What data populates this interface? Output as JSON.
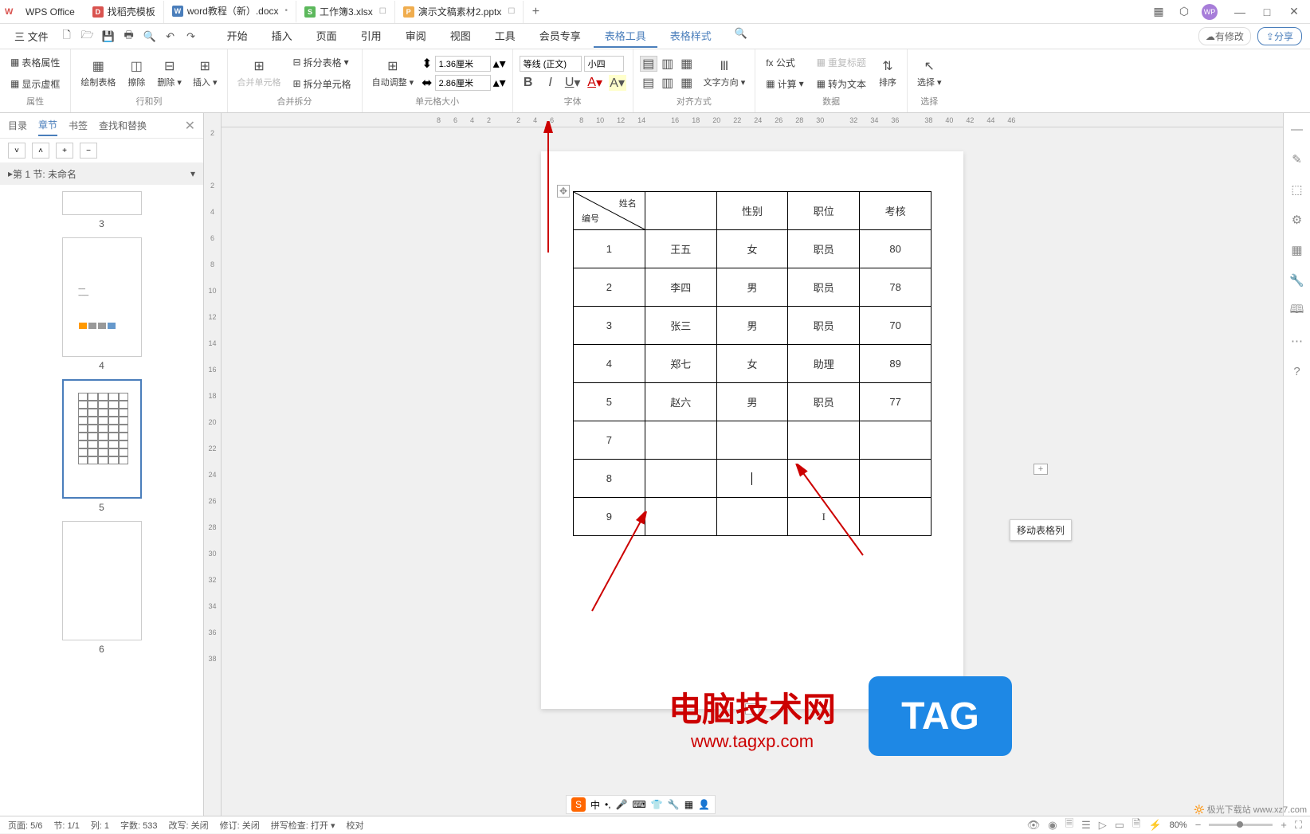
{
  "app": {
    "name": "WPS Office"
  },
  "tabs": [
    {
      "label": "找稻壳模板",
      "iconColor": "red",
      "iconText": "D"
    },
    {
      "label": "word教程（新）.docx",
      "iconColor": "blue",
      "iconText": "W",
      "active": true,
      "modified": true
    },
    {
      "label": "工作簿3.xlsx",
      "iconColor": "green",
      "iconText": "S"
    },
    {
      "label": "演示文稿素材2.pptx",
      "iconColor": "orange",
      "iconText": "P"
    }
  ],
  "avatar": "WP",
  "menu": {
    "file": "三 文件",
    "items": [
      "开始",
      "插入",
      "页面",
      "引用",
      "审阅",
      "视图",
      "工具",
      "会员专享",
      "表格工具",
      "表格样式"
    ],
    "activeIndex": 8,
    "highlightIndex": 9,
    "modify": "有修改",
    "share": "分享"
  },
  "ribbon": {
    "groups": {
      "attr": {
        "label": "属性",
        "btn1": "表格属性",
        "btn2": "显示虚框"
      },
      "rowcol": {
        "label": "行和列",
        "draw": "绘制表格",
        "erase": "擦除",
        "delete": "删除",
        "insert": "插入"
      },
      "merge": {
        "label": "合并拆分",
        "mergeCell": "合并单元格",
        "splitTable": "拆分表格",
        "splitCell": "拆分单元格"
      },
      "size": {
        "label": "单元格大小",
        "auto": "自动调整",
        "w": "1.36厘米",
        "h": "2.86厘米"
      },
      "font": {
        "label": "字体",
        "name": "等线 (正文)",
        "size": "小四"
      },
      "align": {
        "label": "对齐方式",
        "textdir": "文字方向"
      },
      "data": {
        "label": "数据",
        "fx": "fx 公式",
        "calc": "计算",
        "repeat": "重复标题",
        "convert": "转为文本",
        "sort": "排序"
      },
      "select": {
        "label": "选择",
        "btn": "选择"
      }
    }
  },
  "leftPanel": {
    "tabs": [
      "目录",
      "章节",
      "书签",
      "查找和替换"
    ],
    "activeTab": 1,
    "section": "第 1 节: 未命名",
    "pages": [
      "3",
      "4",
      "5",
      "6"
    ],
    "activePage": 2
  },
  "hRuler": [
    "8",
    "6",
    "4",
    "2",
    "",
    "2",
    "4",
    "6",
    "",
    "8",
    "10",
    "12",
    "14",
    "",
    "16",
    "18",
    "20",
    "22",
    "24",
    "26",
    "28",
    "30",
    "",
    "32",
    "34",
    "36",
    "",
    "38",
    "40",
    "42",
    "44",
    "46"
  ],
  "vRuler": [
    "2",
    "",
    "2",
    "4",
    "6",
    "8",
    "10",
    "12",
    "14",
    "16",
    "18",
    "20",
    "22",
    "24",
    "26",
    "28",
    "30",
    "32",
    "34",
    "36",
    "38"
  ],
  "table": {
    "headerDiag": {
      "top": "姓名",
      "bottom": "编号"
    },
    "headers": [
      "性别",
      "职位",
      "考核"
    ],
    "rows": [
      {
        "num": "1",
        "name": "王五",
        "gender": "女",
        "pos": "职员",
        "score": "80"
      },
      {
        "num": "2",
        "name": "李四",
        "gender": "男",
        "pos": "职员",
        "score": "78"
      },
      {
        "num": "3",
        "name": "张三",
        "gender": "男",
        "pos": "职员",
        "score": "70"
      },
      {
        "num": "4",
        "name": "郑七",
        "gender": "女",
        "pos": "助理",
        "score": "89"
      },
      {
        "num": "5",
        "name": "赵六",
        "gender": "男",
        "pos": "职员",
        "score": "77"
      },
      {
        "num": "7",
        "name": "",
        "gender": "",
        "pos": "",
        "score": ""
      },
      {
        "num": "8",
        "name": "",
        "gender": "",
        "pos": "",
        "score": ""
      },
      {
        "num": "9",
        "name": "",
        "gender": "",
        "pos": "",
        "score": ""
      }
    ]
  },
  "tooltip": "移动表格列",
  "watermark": {
    "title": "电脑技术网",
    "url": "www.tagxp.com",
    "tag": "TAG"
  },
  "status": {
    "page": "页面: 5/6",
    "section": "节: 1/1",
    "col": "列: 1",
    "words": "字数: 533",
    "track": "改写: 关闭",
    "revise": "修订: 关闭",
    "spell": "拼写检查: 打开",
    "proof": "校对",
    "zoom": "80%"
  },
  "ime": {
    "lang": "中"
  },
  "corner": "极光下载站\nwww.xz7.com"
}
